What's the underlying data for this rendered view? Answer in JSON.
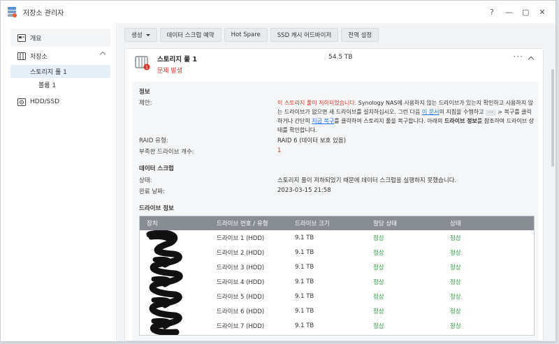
{
  "window": {
    "title": "저장소 관리자",
    "controls": {
      "help": "?",
      "minimize": "—",
      "maximize": "▢",
      "close": "✕"
    }
  },
  "sidebar": {
    "items": [
      {
        "label": "개요",
        "icon": "overview-icon"
      },
      {
        "label": "저장소",
        "icon": "storage-icon"
      },
      {
        "label": "스토리지 풀 1"
      },
      {
        "label": "볼륨 1"
      },
      {
        "label": "HDD/SSD",
        "icon": "hdd-icon"
      }
    ]
  },
  "toolbar": {
    "create": "생성",
    "scrub_schedule": "데이터 스크럽 예약",
    "hot_spare": "Hot Spare",
    "ssd_cache_advisor": "SSD 캐시 어드바이저",
    "global_settings": "전역 설정"
  },
  "pool": {
    "name": "스토리지 풀 1",
    "status": "문제 발생",
    "size": "54.5 TB",
    "badge": "1",
    "more": "···"
  },
  "info": {
    "title": "정보",
    "suggest_label": "제안:",
    "suggest_red": "이 스토리지 풀이 저하되었습니다.",
    "suggest_1": " Synology NAS에 사용하지 않는 드라이브가 있는지 확인하고 사용하지 않는 드라이브가 없으면 새 드라이브를 설치하십시오. 그런 다음 ",
    "suggest_link1": "이 문서",
    "suggest_2": "의 지침을 수행하고 ",
    "suggest_dots": "···",
    "suggest_3": " > 복구를 클릭하거나 간단히 ",
    "suggest_link2": "지금 복구",
    "suggest_4": "를 클릭하여 스토리지 풀을 복구합니다. 아래의 ",
    "suggest_bold": "드라이브 정보",
    "suggest_5": "를 참조하여 드라이브 상태를 확인합니다.",
    "raid_label": "RAID 유형:",
    "raid_value": "RAID 6 (데이터 보호 있음)",
    "missing_label": "부족한 드라이브 개수:",
    "missing_value": "1"
  },
  "scrub": {
    "title": "데이터 스크럽",
    "state_label": "상태:",
    "state_value": "스토리지 풀이 저하되었기 때문에 데이터 스크럽을 실행하지 못했습니다.",
    "done_label": "완료 날짜:",
    "done_value": "2023-03-15 21:58"
  },
  "drives": {
    "title": "드라이브 정보",
    "headers": [
      "장치",
      "드라이브 번호 / 유형",
      "드라이브 크기",
      "할당 상태",
      "상태"
    ],
    "rows": [
      {
        "device": "",
        "number": "드라이브 1 (HDD)",
        "size": "9.1 TB",
        "alloc": "정상",
        "status": "정상"
      },
      {
        "device": "",
        "number": "드라이브 2 (HDD)",
        "size": "9.1 TB",
        "alloc": "정상",
        "status": "정상"
      },
      {
        "device": "",
        "number": "드라이브 3 (HDD)",
        "size": "9.1 TB",
        "alloc": "정상",
        "status": "정상"
      },
      {
        "device": "",
        "number": "드라이브 4 (HDD)",
        "size": "9.1 TB",
        "alloc": "정상",
        "status": "정상"
      },
      {
        "device": "",
        "number": "드라이브 5 (HDD)",
        "size": "9.1 TB",
        "alloc": "정상",
        "status": "정상"
      },
      {
        "device": "",
        "number": "드라이브 6 (HDD)",
        "size": "9.1 TB",
        "alloc": "정상",
        "status": "정상"
      },
      {
        "device": "",
        "number": "드라이브 7 (HDD)",
        "size": "9.1 TB",
        "alloc": "정상",
        "status": "정상"
      }
    ]
  },
  "colors": {
    "error": "#d9362b",
    "ok": "#2f9e44",
    "link": "#1a73e8",
    "table_header": "#888d93"
  }
}
